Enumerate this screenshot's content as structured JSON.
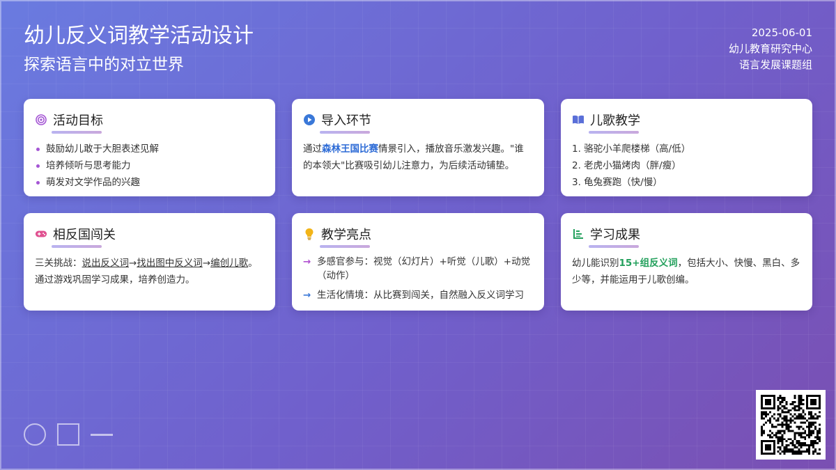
{
  "header": {
    "title": "幼儿反义词教学活动设计",
    "subtitle": "探索语言中的对立世界",
    "date": "2025-06-01",
    "org": "幼儿教育研究中心",
    "group": "语言发展课题组"
  },
  "cards": {
    "goals": {
      "icon": "target-icon",
      "title": "活动目标",
      "items": [
        "鼓励幼儿敢于大胆表述见解",
        "培养倾听与思考能力",
        "萌发对文学作品的兴趣"
      ]
    },
    "intro": {
      "icon": "play-icon",
      "title": "导入环节",
      "text_pre": "通过",
      "highlight": "森林王国比赛",
      "text_post": "情景引入，播放音乐激发兴趣。\"谁的本领大\"比赛吸引幼儿注意力，为后续活动铺垫。"
    },
    "song": {
      "icon": "book-icon",
      "title": "儿歌教学",
      "items": [
        "1. 骆驼小羊爬楼梯（高/低）",
        "2. 老虎小猫烤肉（胖/瘦）",
        "3. 龟兔赛跑（快/慢）"
      ]
    },
    "game": {
      "icon": "gamepad-icon",
      "title": "相反国闯关",
      "prefix": "三关挑战：",
      "step1": "说出反义词",
      "arrow": "→",
      "step2": "找出图中反义词",
      "step3": "编创儿歌",
      "suffix": "。通过游戏巩固学习成果，培养创造力。"
    },
    "highlights": {
      "icon": "lightbulb-icon",
      "title": "教学亮点",
      "arrow_symbol": "→",
      "items": [
        "多感官参与：视觉（幻灯片）+听觉（儿歌）+动觉（动作）",
        "生活化情境：从比赛到闯关，自然融入反义词学习"
      ],
      "arrow_colors": [
        "#b04fd0",
        "#3a78d8"
      ]
    },
    "results": {
      "icon": "bar-chart-icon",
      "title": "学习成果",
      "text_pre": "幼儿能识别",
      "highlight": "15+组反义词",
      "text_post": "，包括大小、快慢、黑白、多少等，并能运用于儿歌创编。"
    }
  },
  "colors": {
    "bg_start": "#6a7be0",
    "bg_end": "#7a4fb2",
    "accent_blue": "#2d6bd6",
    "accent_green": "#23a05c",
    "bullet_purple": "#a455d4"
  }
}
